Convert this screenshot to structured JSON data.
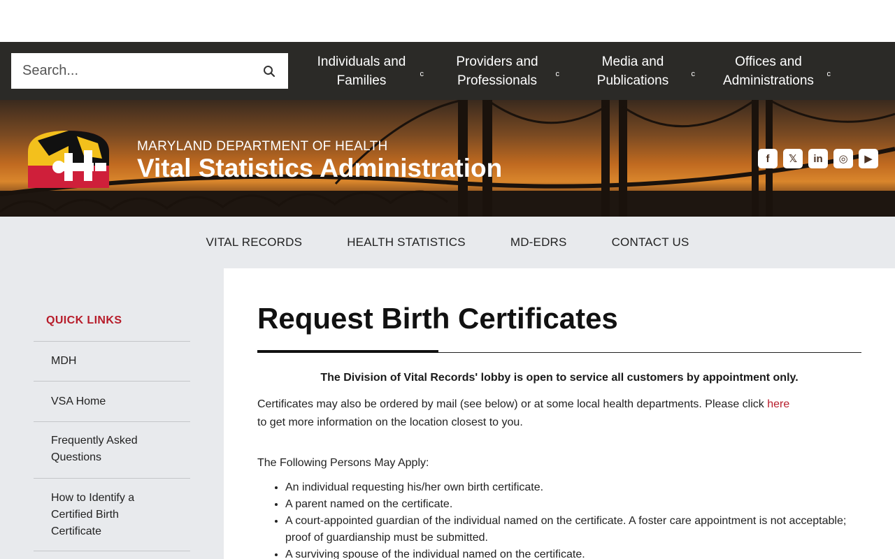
{
  "search": {
    "placeholder": "Search..."
  },
  "utility_nav": [
    {
      "label": "Individuals and Families"
    },
    {
      "label": "Providers and Professionals"
    },
    {
      "label": "Media and Publications"
    },
    {
      "label": "Offices and Administrations"
    }
  ],
  "utility_caret": "c",
  "banner": {
    "department": "MARYLAND DEPARTMENT OF HEALTH",
    "agency": "Vital Statistics Administration"
  },
  "social": [
    "facebook-icon",
    "x-icon",
    "linkedin-icon",
    "instagram-icon",
    "youtube-icon"
  ],
  "main_nav": [
    {
      "label": "VITAL RECORDS"
    },
    {
      "label": "HEALTH STATISTICS"
    },
    {
      "label": "MD-EDRS"
    },
    {
      "label": "CONTACT US"
    }
  ],
  "sidebar": {
    "title": "QUICK LINKS",
    "items": [
      {
        "label": "MDH"
      },
      {
        "label": "VSA Home"
      },
      {
        "label": "Frequently Asked Questions"
      },
      {
        "label": "How to Identify a Certified Birth Certificate"
      }
    ]
  },
  "content": {
    "title": "Request Birth Certificates",
    "notice": "The Division of Vital Records' lobby is open to service all customers by appointment only.",
    "para_before_link": "Certificates may also be ordered by mail (see below) or at some local health departments. Please click ",
    "para_link": "here",
    "para_after_link": "  to get more information on the location closest to you.",
    "apply_heading": "The Following Persons May Apply:",
    "bullets": [
      "An individual requesting his/her own birth certificate.",
      "A parent named on the certificate.",
      "A court-appointed guardian of the individual named on the certificate. A foster care appointment is not acceptable; proof of guardianship must be submitted.",
      "A surviving spouse of the individual named on the certificate."
    ]
  },
  "colors": {
    "accent_red": "#b71c2a",
    "utility_bar": "#2b2a27",
    "nav_bg": "#e8eaed"
  }
}
